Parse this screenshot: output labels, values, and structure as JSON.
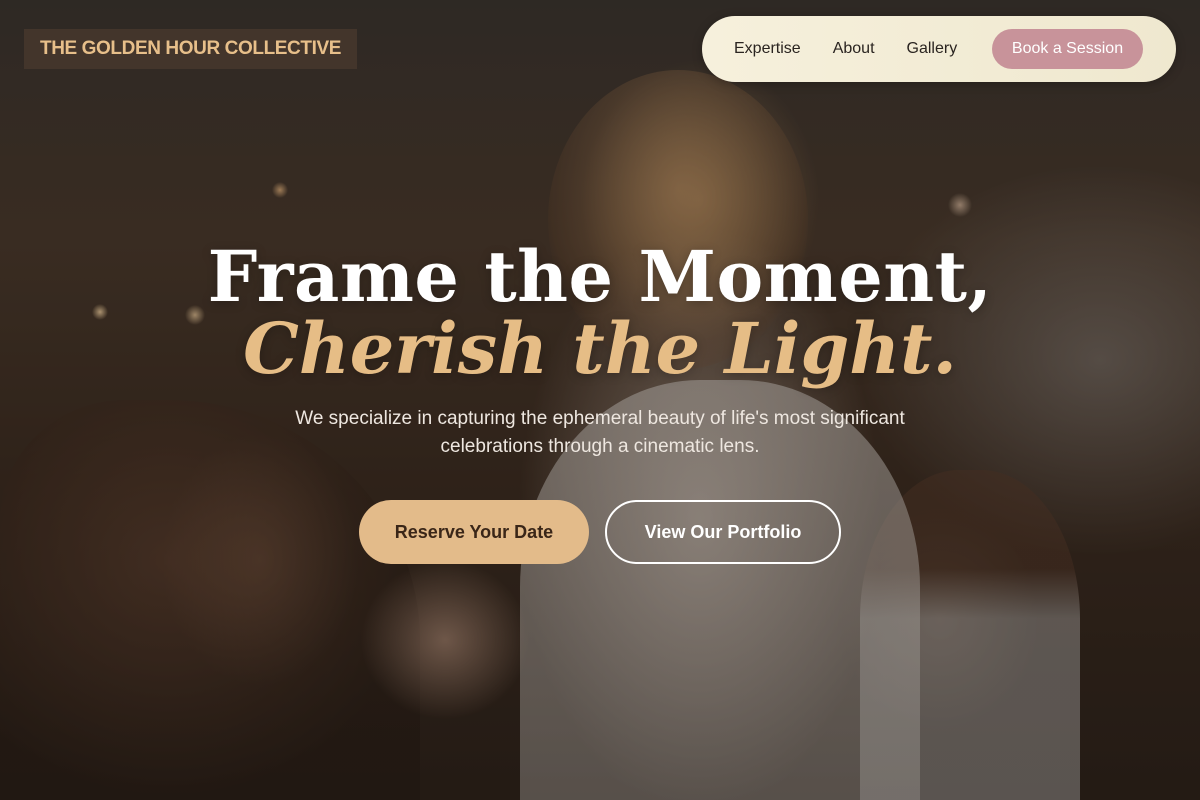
{
  "brand": {
    "name": "THE GOLDEN HOUR COLLECTIVE",
    "accent_color": "#e6bd86"
  },
  "nav": {
    "links": [
      "Expertise",
      "About",
      "Gallery"
    ],
    "cta_label": "Book a Session",
    "cta_color": "#c8939a",
    "background_color": "#f3ecd6"
  },
  "hero": {
    "headline_line1": "Frame the Moment,",
    "headline_line2": "Cherish the Light.",
    "subtitle": "We specialize in capturing the ephemeral beauty of life's most significant celebrations through a cinematic lens.",
    "primary_button_label": "Reserve Your Date",
    "secondary_button_label": "View Our Portfolio",
    "primary_button_color": "#e3bb8a"
  }
}
